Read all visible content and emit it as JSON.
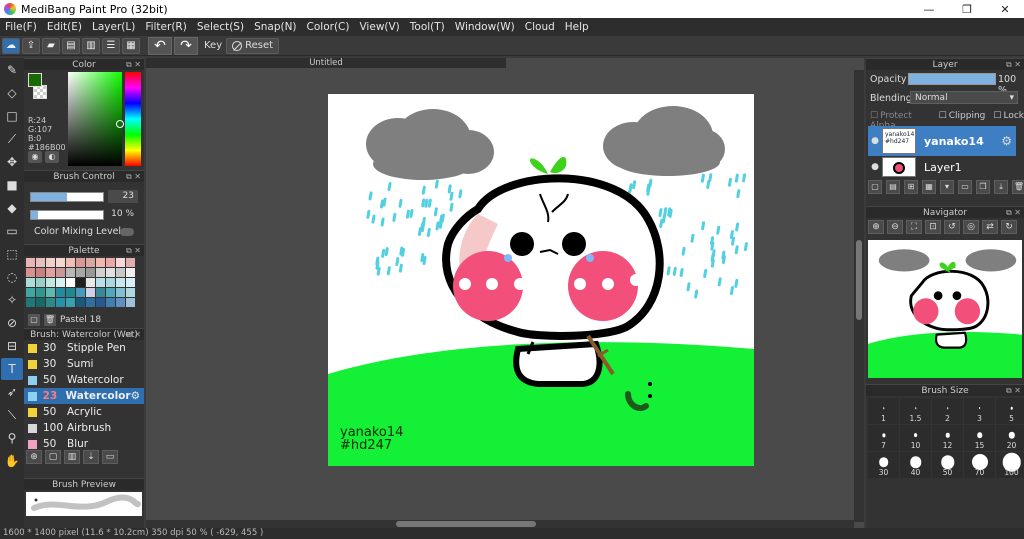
{
  "window": {
    "title": "MediBang Paint Pro (32bit)",
    "minimize": "—",
    "restore": "❐",
    "close": "✕"
  },
  "menu": [
    "File(F)",
    "Edit(E)",
    "Layer(L)",
    "Filter(R)",
    "Select(S)",
    "Snap(N)",
    "Color(C)",
    "View(V)",
    "Tool(T)",
    "Window(W)",
    "Cloud",
    "Help"
  ],
  "toolbar": {
    "key_label": "Key",
    "reset_label": "Reset"
  },
  "document": {
    "tab_title": "Untitled",
    "signature_line1": "yanako14",
    "signature_line2": "#hd247"
  },
  "color": {
    "panel_title": "Color",
    "foreground": "#186B00",
    "r": "R:24",
    "g": "G:107",
    "b": "B:0",
    "hex": "#186B00"
  },
  "brush_control": {
    "panel_title": "Brush Control",
    "size_value": "23",
    "size_fraction": 0.5,
    "opacity_value": "10 %",
    "opacity_fraction": 0.1,
    "color_mixing_label": "Color Mixing Level"
  },
  "palette": {
    "panel_title": "Palette",
    "name": "Pastel 18",
    "colors": [
      "#e8b4b4",
      "#e8c0c0",
      "#f0d0c8",
      "#f4d8d0",
      "#f0c0b8",
      "#d89898",
      "#d8a8a0",
      "#f0b8b0",
      "#e8a8a8",
      "#f8d8d8",
      "#e0b0b0",
      "#d89090",
      "#c88080",
      "#e0a0a0",
      "#c89898",
      "#b8b8b8",
      "#a8a8a8",
      "#989898",
      "#d0d0d0",
      "#e0e0e0",
      "#c8c8c8",
      "#f0f0f0",
      "#a8e0d8",
      "#98d0c8",
      "#c0e8e0",
      "#d8f0f0",
      "#ffffff",
      "#202020",
      "#e8e8e8",
      "#b8e0e8",
      "#a8d8e0",
      "#c8e8f0",
      "#d8f0f8",
      "#40a8a0",
      "#309890",
      "#60b8b0",
      "#2888a0",
      "#208890",
      "#4898c0",
      "#d0d0e8",
      "#388898",
      "#50a8b8",
      "#80c0d0",
      "#b0d8e0",
      "#207878",
      "#186868",
      "#308888",
      "#2890a8",
      "#38a0b0",
      "#1a5a7a",
      "#3070a0",
      "#285890",
      "#4080b0",
      "#6090c0",
      "#a0c0d8"
    ]
  },
  "brushes": {
    "panel_title": "Brush: Watercolor (Wet)",
    "items": [
      {
        "size": "30",
        "name": "Stipple Pen",
        "color": "#f2d43a"
      },
      {
        "size": "30",
        "name": "Sumi",
        "color": "#f2d43a"
      },
      {
        "size": "50",
        "name": "Watercolor",
        "color": "#8ed0f0"
      },
      {
        "size": "23",
        "name": "Watercolor",
        "color": "#8ed0f0",
        "selected": true
      },
      {
        "size": "50",
        "name": "Acrylic",
        "color": "#f2d43a"
      },
      {
        "size": "100",
        "name": "Airbrush",
        "color": "#d8d8d8"
      },
      {
        "size": "50",
        "name": "Blur",
        "color": "#f0a0c0"
      }
    ]
  },
  "brush_preview": {
    "panel_title": "Brush Preview"
  },
  "layer": {
    "panel_title": "Layer",
    "opacity_label": "Opacity",
    "opacity_value": "100 %",
    "opacity_fraction": 1.0,
    "blending_label": "Blending",
    "blending_value": "Normal",
    "protect_alpha": "Protect Alpha",
    "clipping": "Clipping",
    "lock": "Lock",
    "layers": [
      {
        "name": "yanako14",
        "selected": true,
        "thumb_text": "yanako14\n#hd247"
      },
      {
        "name": "Layer1",
        "selected": false
      }
    ]
  },
  "navigator": {
    "panel_title": "Navigator"
  },
  "brush_size": {
    "panel_title": "Brush Size",
    "sizes": [
      "1",
      "1.5",
      "2",
      "3",
      "5",
      "7",
      "10",
      "12",
      "15",
      "20",
      "30",
      "40",
      "50",
      "70",
      "100"
    ],
    "dot_fraction": [
      0.03,
      0.04,
      0.05,
      0.06,
      0.08,
      0.1,
      0.12,
      0.14,
      0.17,
      0.2,
      0.3,
      0.36,
      0.42,
      0.5,
      0.58
    ]
  },
  "status": {
    "text": "1600 * 1400 pixel   (11.6 * 10.2cm)   350 dpi   50 %   ( -629, 455 )"
  }
}
